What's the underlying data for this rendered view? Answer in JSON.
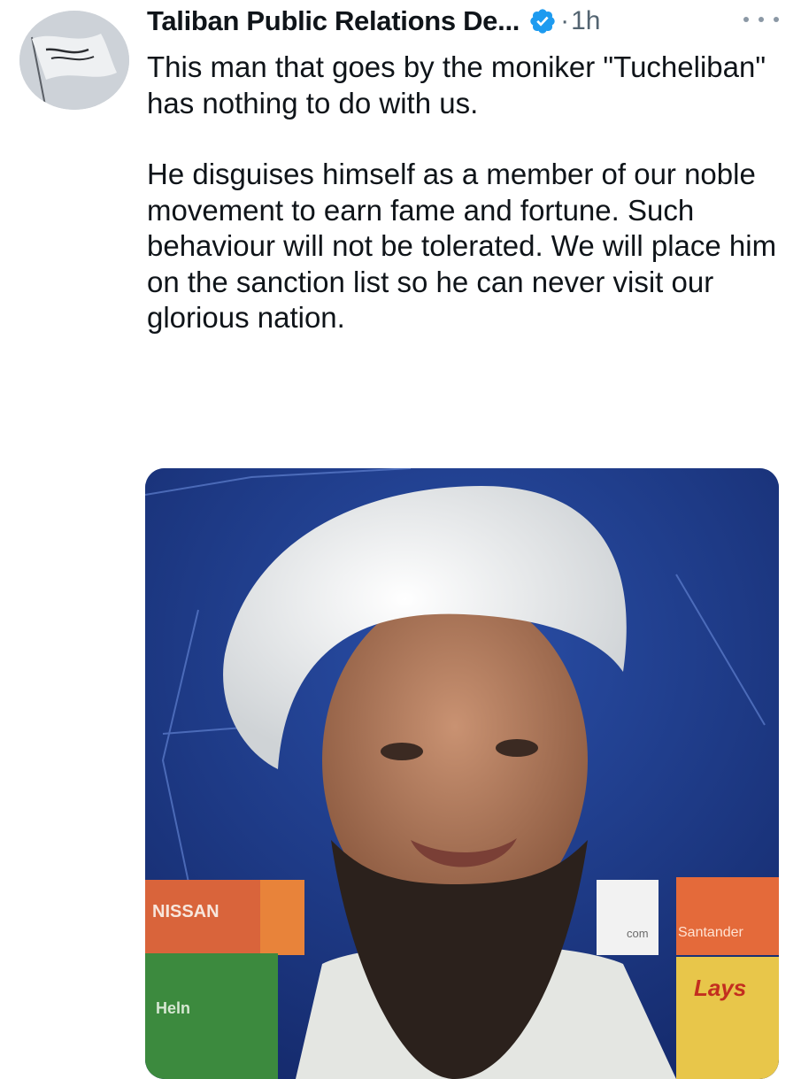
{
  "tweet": {
    "author_name": "Taliban Public Relations De...",
    "separator": "·",
    "timestamp": "1h",
    "verified": true,
    "paragraphs": [
      "This man that goes by the moniker \"Tucheliban\" has nothing to do with us.",
      "He disguises himself as a member of our noble movement to earn fame and fortune. Such behaviour will not be tolerated. We will place him on the sanction list so he can never visit our glorious nation."
    ]
  },
  "media": {
    "board_labels": [
      "NISSAN",
      "Santander",
      "com",
      "Heln",
      "Lays"
    ],
    "icons": [
      "more-icon",
      "verified-badge-icon"
    ]
  },
  "colors": {
    "verified_blue": "#1d9bf0",
    "muted_text": "#536471",
    "backdrop_blue": "#19337a"
  }
}
